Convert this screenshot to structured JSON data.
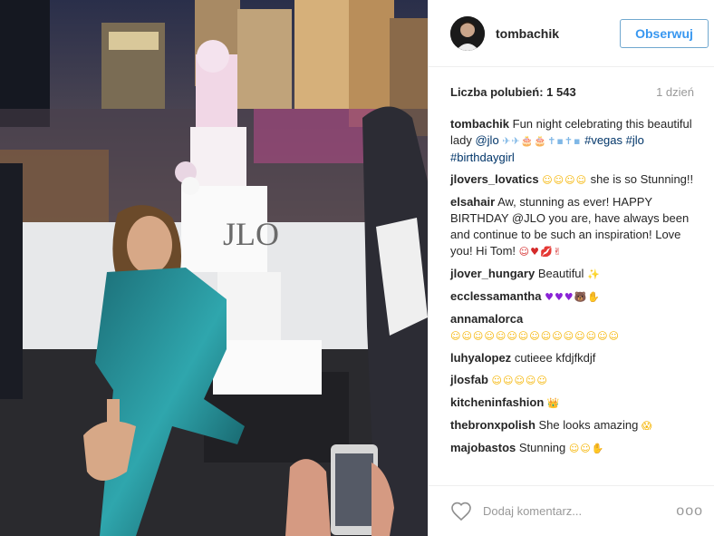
{
  "post": {
    "username": "tombachik",
    "follow_label": "Obserwuj",
    "likes_text": "Liczba polubień: 1 543",
    "age_text": "1 dzień",
    "cake_text": "JLO"
  },
  "comments": [
    {
      "user": "tombachik",
      "text": "Fun night celebrating this beautiful lady ",
      "mention": "@jlo",
      "emoji": "✈✈🎂🎂✝▪✝▪",
      "tags": "#vegas #jlo #birthdaygirl"
    },
    {
      "user": "jlovers_lovatics",
      "emoji": "☺☺☺☺",
      "text": " she is so Stunning!!"
    },
    {
      "user": "elsahair",
      "text": "Aw, stunning as ever! HAPPY BIRTHDAY @JLO you are, have always been and continue to be such an inspiration! Love you! Hi Tom! ",
      "emoji": "☺♥💋✌"
    },
    {
      "user": "jlover_hungary",
      "text": "Beautiful ",
      "emoji": "✨"
    },
    {
      "user": "ecclessamantha",
      "emoji": "♥♥♥🐻✋"
    },
    {
      "user": "annamalorca",
      "emoji": "☺☺☺☺☺☺☺☺☺☺☺☺☺☺☺"
    },
    {
      "user": "luhyalopez",
      "text": "cutieee kfdjfkdjf"
    },
    {
      "user": "jlosfab",
      "emoji": "☺☺☺☺☺"
    },
    {
      "user": "kitcheninfashion",
      "emoji": "👑"
    },
    {
      "user": "thebronxpolish",
      "text": "She looks amazing ",
      "emoji": "😱"
    },
    {
      "user": "majobastos",
      "text": "Stunning ",
      "emoji": "☺☺✋"
    }
  ],
  "footer": {
    "add_comment_placeholder": "Dodaj komentarz...",
    "more_label": "ooo"
  },
  "colors": {
    "accent_blue": "#3897f0",
    "text": "#262626",
    "muted": "#999999"
  }
}
